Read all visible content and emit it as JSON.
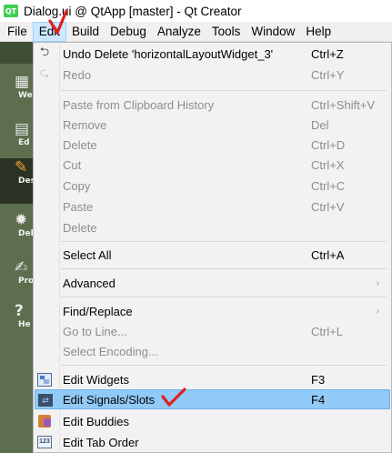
{
  "window": {
    "title": "Dialog.ui @ QtApp [master] - Qt Creator",
    "app_icon_text": "QT"
  },
  "menubar": [
    {
      "label": "File"
    },
    {
      "label": "Edit",
      "active": true
    },
    {
      "label": "Build"
    },
    {
      "label": "Debug"
    },
    {
      "label": "Analyze"
    },
    {
      "label": "Tools"
    },
    {
      "label": "Window"
    },
    {
      "label": "Help"
    }
  ],
  "modebar": [
    {
      "label": "Welc",
      "icon": "welcome-icon"
    },
    {
      "label": "Ed",
      "icon": "edit-icon"
    },
    {
      "label": "Des",
      "icon": "design-icon",
      "selected": true
    },
    {
      "label": "Deb",
      "icon": "debug-icon"
    },
    {
      "label": "Proj",
      "icon": "projects-icon"
    },
    {
      "label": "He",
      "icon": "help-icon"
    }
  ],
  "edit_menu": {
    "undo": {
      "label": "Undo Delete 'horizontalLayoutWidget_3'",
      "shortcut": "Ctrl+Z"
    },
    "redo": {
      "label": "Redo",
      "shortcut": "Ctrl+Y"
    },
    "paste_history": {
      "label": "Paste from Clipboard History",
      "shortcut": "Ctrl+Shift+V"
    },
    "remove": {
      "label": "Remove",
      "shortcut": "Del"
    },
    "delete1": {
      "label": "Delete",
      "shortcut": "Ctrl+D"
    },
    "cut": {
      "label": "Cut",
      "shortcut": "Ctrl+X"
    },
    "copy": {
      "label": "Copy",
      "shortcut": "Ctrl+C"
    },
    "paste": {
      "label": "Paste",
      "shortcut": "Ctrl+V"
    },
    "delete2": {
      "label": "Delete",
      "shortcut": ""
    },
    "select_all": {
      "label": "Select All",
      "shortcut": "Ctrl+A"
    },
    "advanced": {
      "label": "Advanced",
      "arrow": "›"
    },
    "find_replace": {
      "label": "Find/Replace",
      "arrow": "›"
    },
    "goto_line": {
      "label": "Go to Line...",
      "shortcut": "Ctrl+L"
    },
    "select_encoding": {
      "label": "Select Encoding..."
    },
    "edit_widgets": {
      "label": "Edit Widgets",
      "shortcut": "F3"
    },
    "edit_signals_slots": {
      "label": "Edit Signals/Slots",
      "shortcut": "F4",
      "highlighted": true
    },
    "edit_buddies": {
      "label": "Edit Buddies"
    },
    "edit_tab_order": {
      "label": "Edit Tab Order",
      "tab_icon_text": "123"
    }
  },
  "colors": {
    "highlight": "#91c9f7",
    "menubar_active": "#cce8ff",
    "modebar": "#5c6e4e",
    "annotation_red": "#e0201b"
  }
}
